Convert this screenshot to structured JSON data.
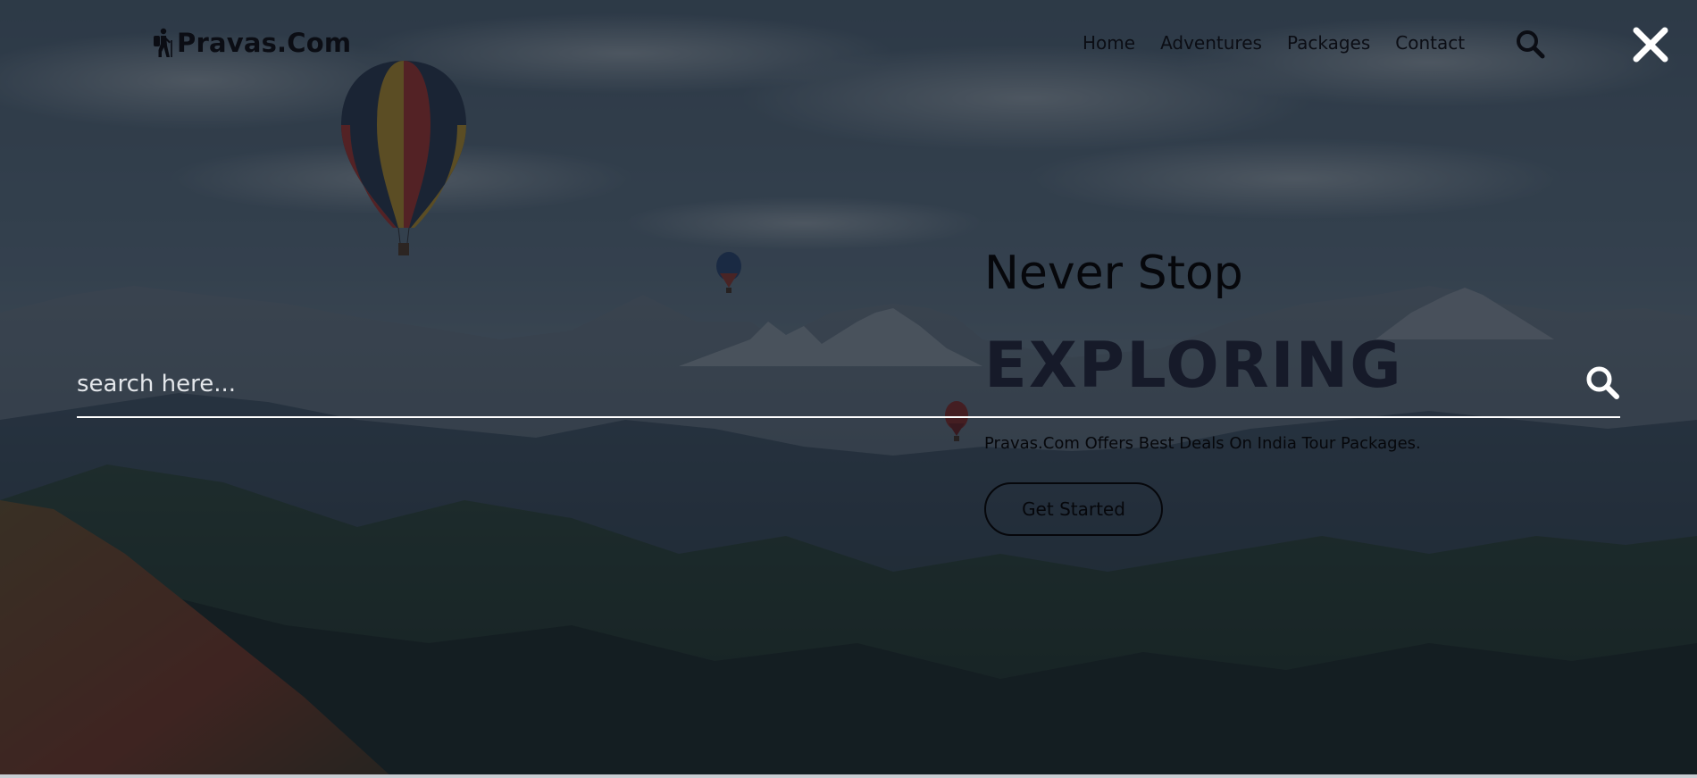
{
  "brand": {
    "name": "Pravas.Com",
    "logo_icon": "hiker-icon"
  },
  "nav": {
    "links": [
      {
        "label": "Home"
      },
      {
        "label": "Adventures"
      },
      {
        "label": "Packages"
      },
      {
        "label": "Contact"
      }
    ],
    "search_icon": "search-icon",
    "close_icon": "close-icon"
  },
  "search": {
    "placeholder": "search here...",
    "value": "",
    "submit_icon": "search-icon"
  },
  "hero": {
    "subtitle": "Never Stop",
    "title": "EXPLORING",
    "description": "Pravas.Com Offers Best Deals On India Tour Packages.",
    "cta_label": "Get Started"
  },
  "colors": {
    "overlay": "#101722",
    "text_dark": "#06070b",
    "title": "#161a29",
    "search_line": "#ffffff"
  }
}
